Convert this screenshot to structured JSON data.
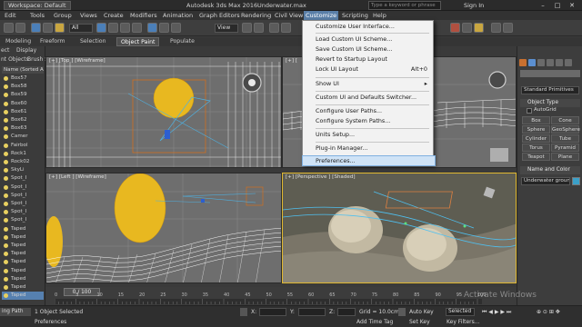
{
  "titlebar": {
    "workspace": "Workspace: Default",
    "app": "Autodesk 3ds Max 2016",
    "file": "Underwater.max",
    "search_placeholder": "Type a keyword or phrase",
    "signin": "Sign In"
  },
  "menubar": {
    "items": [
      "Edit",
      "Tools",
      "Group",
      "Views",
      "Create",
      "Modifiers",
      "Animation",
      "Graph Editors",
      "Rendering",
      "Civil View",
      "Customize",
      "Scripting",
      "Help"
    ],
    "active_index": 10
  },
  "toolbar": {
    "view_select": "View"
  },
  "ribbon": {
    "tabs": [
      "Modeling",
      "Freeform",
      "Selection",
      "Object Paint",
      "Populate"
    ],
    "selected_index": 3
  },
  "leftpanel": {
    "tabs": [
      "ect",
      "Display"
    ],
    "sub_tabs": [
      "nt Objects",
      "Brush Settings"
    ],
    "header": "Name (Sorted Ascen",
    "items": [
      "Box57",
      "Box58",
      "Box59",
      "Box60",
      "Box61",
      "Box62",
      "Box63",
      "Camer",
      "Fairbol",
      "Rock1",
      "Rock02",
      "SkyLi",
      "Spot_I",
      "Spot_I",
      "Spot_I",
      "Spot_I",
      "Spot_I",
      "Spot_I",
      "Taped",
      "Taped",
      "Taped",
      "Taped",
      "Taped",
      "Taped",
      "Taped",
      "Taped",
      "Taped"
    ],
    "selected_index": 26
  },
  "viewports": {
    "top_left_label": "[+] [Top ] [Wireframe]",
    "top_right_label": "[+] [ ",
    "bottom_left_label": "[+] [Left ] [Wireframe]",
    "bottom_right_label": "[+] [Perspective ] [Shaded]"
  },
  "dropdown": {
    "items": [
      {
        "label": "Customize User Interface...",
        "shortcut": ""
      },
      {
        "label": "Load Custom UI Scheme...",
        "shortcut": ""
      },
      {
        "label": "Save Custom UI Scheme...",
        "shortcut": ""
      },
      {
        "label": "Revert to Startup Layout",
        "shortcut": ""
      },
      {
        "label": "Lock UI Layout",
        "shortcut": "Alt+0"
      },
      {
        "label": "Show UI",
        "shortcut": "▸"
      },
      {
        "label": "Custom UI and Defaults Switcher...",
        "shortcut": ""
      },
      {
        "label": "Configure User Paths...",
        "shortcut": ""
      },
      {
        "label": "Configure System Paths...",
        "shortcut": ""
      },
      {
        "label": "Units Setup...",
        "shortcut": ""
      },
      {
        "label": "Plug-in Manager...",
        "shortcut": ""
      },
      {
        "label": "Preferences...",
        "shortcut": ""
      }
    ],
    "highlighted_index": 11
  },
  "cmdpanel": {
    "dropdown": "Standard Primitives",
    "object_type": "Object Type",
    "autogrid": "AutoGrid",
    "buttons": [
      "Box",
      "Cone",
      "Sphere",
      "GeoSphere",
      "Cylinder",
      "Tube",
      "Torus",
      "Pyramid",
      "Teapot",
      "Plane"
    ],
    "name_and_color": "Name and Color",
    "name_value": "Underwater ground"
  },
  "timeline": {
    "frame": "0 / 100",
    "ticks": [
      "0",
      "5",
      "10",
      "15",
      "20",
      "25",
      "30",
      "35",
      "40",
      "45",
      "50",
      "55",
      "60",
      "65",
      "70",
      "75",
      "80",
      "85",
      "90",
      "95",
      "100"
    ]
  },
  "status": {
    "selected": "1 Object Selected",
    "prompt": "Preferences",
    "left_label": "ing Path",
    "x_label": "X:",
    "y_label": "Y:",
    "z_label": "Z:",
    "grid": "Grid = 10.0cm",
    "auto_key": "Auto Key",
    "selected_dd": "Selected",
    "set_key": "Set Key",
    "key_filters": "Key Filters...",
    "add_time_tag": "Add Time Tag",
    "watermark": "Activate Windows"
  },
  "colors": {
    "accent": "#5a7fa8",
    "active_viewport": "#e0b830",
    "highlight": "#cfe3f6"
  }
}
